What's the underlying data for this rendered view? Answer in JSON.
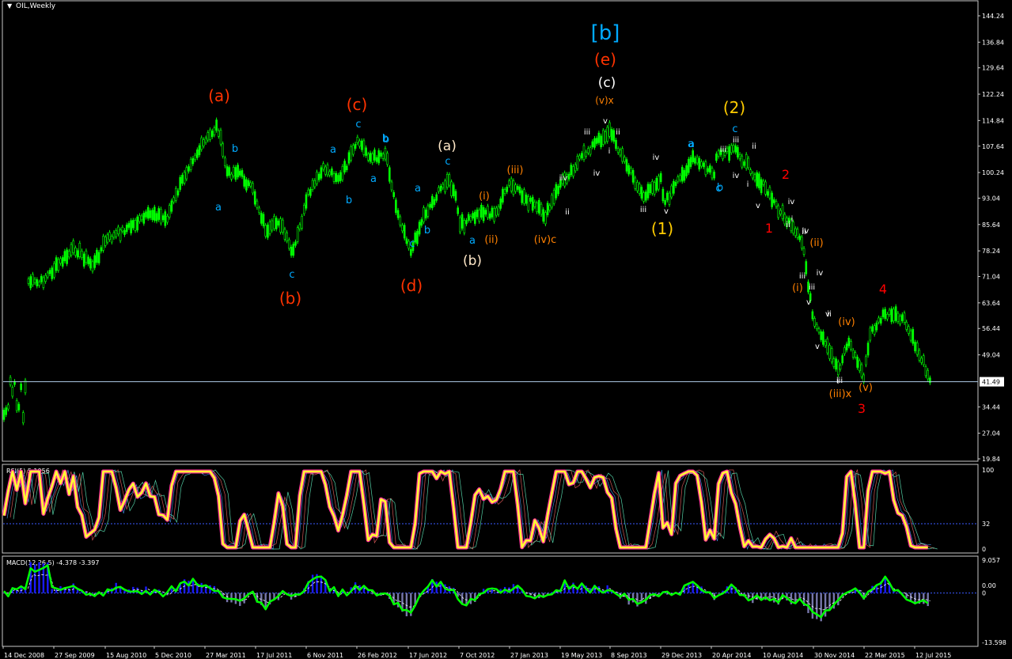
{
  "window": {
    "title": "OIL,Weekly",
    "menu_glyph": "▼"
  },
  "colors": {
    "background": "#000000",
    "frame": "#c8c8c8",
    "bull_candle": "#00ff00",
    "price_line": "#a8c4e0",
    "rsi_main": "#ffff33",
    "rsi_glow": "#ff3399",
    "macd_hist": "#1a1aff",
    "macd_line": "#00ff00",
    "signal_line": "#ffffff",
    "wave_red": "#ff3300",
    "wave_blue": "#00aaff",
    "wave_orange": "#ff8000",
    "wave_gold": "#ffcc00",
    "wave_white": "#ffffff",
    "wave_cream": "#ffe8c8",
    "wave_pure_red": "#ff0000"
  },
  "chart_data": [
    {
      "type": "candlestick",
      "title": "OIL,Weekly",
      "symbol": "OIL",
      "timeframe": "Weekly",
      "current_price": 41.49,
      "current_price_label": "41.49",
      "ylim": [
        19.84,
        144.24
      ],
      "y_ticks": [
        "144.24",
        "136.84",
        "129.64",
        "122.24",
        "114.84",
        "107.64",
        "100.24",
        "93.04",
        "85.64",
        "78.24",
        "71.04",
        "63.64",
        "56.44",
        "49.04",
        "41.49",
        "34.44",
        "27.04",
        "19.84"
      ],
      "x_ticks": [
        "14 Dec 2008",
        "27 Sep 2009",
        "15 Aug 2010",
        "5 Dec 2010",
        "27 Mar 2011",
        "17 Jul 2011",
        "6 Nov 2011",
        "26 Feb 2012",
        "17 Jun 2012",
        "7 Oct 2012",
        "27 Jan 2013",
        "19 May 2013",
        "8 Sep 2013",
        "29 Dec 2013",
        "20 Apr 2014",
        "10 Aug 2014",
        "30 Nov 2014",
        "22 Mar 2015",
        "12 Jul 2015"
      ],
      "price_path": [
        {
          "x": "14 Dec 2008",
          "y": 36.0
        },
        {
          "x": "Jan 2009",
          "y": 71.0
        },
        {
          "x": "Jun 2009",
          "y": 69.0
        },
        {
          "x": "27 Sep 2009",
          "y": 73.0
        },
        {
          "x": "Jan 2010",
          "y": 79.0
        },
        {
          "x": "May 2010",
          "y": 74.0
        },
        {
          "x": "15 Aug 2010",
          "y": 81.0
        },
        {
          "x": "5 Dec 2010",
          "y": 89.0
        },
        {
          "x": "Jan 2011",
          "y": 87.0
        },
        {
          "x": "Feb 2011",
          "y": 103.0
        },
        {
          "x": "Apr 2011",
          "y": 113.5
        },
        {
          "x": "May 2011",
          "y": 99.5
        },
        {
          "x": "Jun 2011",
          "y": 101.0
        },
        {
          "x": "Jul 2011",
          "y": 95.0
        },
        {
          "x": "Aug 2011",
          "y": 83.0
        },
        {
          "x": "Sep 2011",
          "y": 87.0
        },
        {
          "x": "Oct 2011",
          "y": 77.0
        },
        {
          "x": "Nov 2011",
          "y": 94.0
        },
        {
          "x": "Dec 2011",
          "y": 101.5
        },
        {
          "x": "Jan 2012",
          "y": 98.5
        },
        {
          "x": "Feb 2012",
          "y": 109.0
        },
        {
          "x": "Mar 2012",
          "y": 104.0
        },
        {
          "x": "Apr 2012",
          "y": 106.0
        },
        {
          "x": "May 2012",
          "y": 91.0
        },
        {
          "x": "Jun 2012",
          "y": 78.0
        },
        {
          "x": "Jul 2012",
          "y": 88.0
        },
        {
          "x": "Aug 2012",
          "y": 98.5
        },
        {
          "x": "Sep 2012",
          "y": 92.0
        },
        {
          "x": "7 Oct 2012",
          "y": 85.0
        },
        {
          "x": "Nov 2012",
          "y": 89.5
        },
        {
          "x": "Dec 2012",
          "y": 88.0
        },
        {
          "x": "27 Jan 2013",
          "y": 97.0
        },
        {
          "x": "Apr 2013",
          "y": 88.0
        },
        {
          "x": "19 May 2013",
          "y": 97.0
        },
        {
          "x": "Jul 2013",
          "y": 107.0
        },
        {
          "x": "8 Sep 2013",
          "y": 112.0
        },
        {
          "x": "Oct 2013",
          "y": 101.0
        },
        {
          "x": "Nov 2013",
          "y": 93.0
        },
        {
          "x": "29 Dec 2013",
          "y": 99.0
        },
        {
          "x": "Jan 2014",
          "y": 91.5
        },
        {
          "x": "Mar 2014",
          "y": 104.0
        },
        {
          "x": "Apr 2014",
          "y": 99.5
        },
        {
          "x": "20 Apr 2014",
          "y": 104.0
        },
        {
          "x": "Jun 2014",
          "y": 106.5
        },
        {
          "x": "10 Aug 2014",
          "y": 97.0
        },
        {
          "x": "Sep 2014",
          "y": 92.0
        },
        {
          "x": "Oct 2014",
          "y": 80.0
        },
        {
          "x": "30 Nov 2014",
          "y": 58.0
        },
        {
          "x": "Jan 2015",
          "y": 45.0
        },
        {
          "x": "Feb 2015",
          "y": 53.0
        },
        {
          "x": "22 Mar 2015",
          "y": 43.0
        },
        {
          "x": "Apr 2015",
          "y": 55.0
        },
        {
          "x": "May 2015",
          "y": 60.5
        },
        {
          "x": "Jun 2015",
          "y": 59.0
        },
        {
          "x": "12 Jul 2015",
          "y": 41.5
        }
      ],
      "wave_labels": [
        {
          "text": "(a)",
          "color": "#ff3300",
          "size": 20
        },
        {
          "text": "(b)",
          "color": "#ff3300",
          "size": 20
        },
        {
          "text": "(c)",
          "color": "#ff3300",
          "size": 20
        },
        {
          "text": "(d)",
          "color": "#ff3300",
          "size": 20
        },
        {
          "text": "(e)",
          "color": "#ff3300",
          "size": 20
        },
        {
          "text": "[b]",
          "color": "#00aaff",
          "size": 26
        },
        {
          "text": "(c)",
          "color": "#ffffff",
          "size": 17
        },
        {
          "text": "(v)x",
          "color": "#ff8000",
          "size": 12
        },
        {
          "text": "(a)",
          "color": "#ffe8c8",
          "size": 17
        },
        {
          "text": "(b)",
          "color": "#ffe8c8",
          "size": 17
        },
        {
          "text": "(1)",
          "color": "#ffcc00",
          "size": 20
        },
        {
          "text": "(2)",
          "color": "#ffcc00",
          "size": 20
        },
        {
          "text": "1",
          "color": "#ff0000",
          "size": 16
        },
        {
          "text": "2",
          "color": "#ff0000",
          "size": 16
        },
        {
          "text": "3",
          "color": "#ff0000",
          "size": 16
        },
        {
          "text": "4",
          "color": "#ff0000",
          "size": 16
        },
        {
          "text": "a",
          "color": "#00aaff",
          "size": 13
        },
        {
          "text": "b",
          "color": "#00aaff",
          "size": 13
        },
        {
          "text": "c",
          "color": "#00aaff",
          "size": 13
        },
        {
          "text": "b",
          "color": "#00aaff",
          "size": 13
        },
        {
          "text": "a",
          "color": "#00aaff",
          "size": 13
        },
        {
          "text": "b",
          "color": "#00aaff",
          "size": 13
        },
        {
          "text": "c",
          "color": "#00aaff",
          "size": 13
        },
        {
          "text": "c",
          "color": "#00aaff",
          "size": 13
        },
        {
          "text": "a",
          "color": "#00aaff",
          "size": 13
        },
        {
          "text": "b",
          "color": "#00aaff",
          "size": 13
        },
        {
          "text": "a",
          "color": "#00aaff",
          "size": 13
        },
        {
          "text": "c",
          "color": "#00aaff",
          "size": 13
        },
        {
          "text": "a",
          "color": "#00aaff",
          "size": 13
        },
        {
          "text": "b",
          "color": "#00aaff",
          "size": 13
        },
        {
          "text": "c",
          "color": "#00aaff",
          "size": 13
        },
        {
          "text": "a",
          "color": "#00aaff",
          "size": 13
        },
        {
          "text": "b",
          "color": "#00aaff",
          "size": 13
        },
        {
          "text": "c",
          "color": "#00aaff",
          "size": 13
        },
        {
          "text": "a",
          "color": "#00aaff",
          "size": 13
        },
        {
          "text": "(i)",
          "color": "#ff8000",
          "size": 13
        },
        {
          "text": "(ii)",
          "color": "#ff8000",
          "size": 13
        },
        {
          "text": "(iii)",
          "color": "#ff8000",
          "size": 13
        },
        {
          "text": "(iv)c",
          "color": "#ff8000",
          "size": 13
        },
        {
          "text": "(i)",
          "color": "#ff8000",
          "size": 13
        },
        {
          "text": "(ii)",
          "color": "#ff8000",
          "size": 13
        },
        {
          "text": "(iv)",
          "color": "#ff8000",
          "size": 13
        },
        {
          "text": "(iii)x",
          "color": "#ff8000",
          "size": 13
        },
        {
          "text": "(v)",
          "color": "#ff8000",
          "size": 13
        },
        {
          "text": "i",
          "color": "#ffffff",
          "size": 10
        },
        {
          "text": "ii",
          "color": "#ffffff",
          "size": 10
        },
        {
          "text": "iii",
          "color": "#ffffff",
          "size": 10
        },
        {
          "text": "iv",
          "color": "#ffffff",
          "size": 10
        },
        {
          "text": "v",
          "color": "#ffffff",
          "size": 10
        },
        {
          "text": "i",
          "color": "#ffffff",
          "size": 10
        },
        {
          "text": "ii",
          "color": "#ffffff",
          "size": 10
        },
        {
          "text": "iii",
          "color": "#ffffff",
          "size": 10
        },
        {
          "text": "iv",
          "color": "#ffffff",
          "size": 10
        },
        {
          "text": "v",
          "color": "#ffffff",
          "size": 10
        },
        {
          "text": "iii",
          "color": "#ffffff",
          "size": 10
        },
        {
          "text": "iv",
          "color": "#ffffff",
          "size": 10
        },
        {
          "text": "i",
          "color": "#ffffff",
          "size": 10
        },
        {
          "text": "ii",
          "color": "#ffffff",
          "size": 10
        },
        {
          "text": "iii",
          "color": "#ffffff",
          "size": 10
        },
        {
          "text": "iv",
          "color": "#ffffff",
          "size": 10
        },
        {
          "text": "v",
          "color": "#ffffff",
          "size": 10
        },
        {
          "text": "ii",
          "color": "#ffffff",
          "size": 10
        },
        {
          "text": "iii",
          "color": "#ffffff",
          "size": 10
        },
        {
          "text": "iv",
          "color": "#ffffff",
          "size": 10
        },
        {
          "text": "v",
          "color": "#ffffff",
          "size": 10
        },
        {
          "text": "ii",
          "color": "#ffffff",
          "size": 10
        },
        {
          "text": "iii",
          "color": "#ffffff",
          "size": 10
        },
        {
          "text": "iv",
          "color": "#ffffff",
          "size": 10
        },
        {
          "text": "i",
          "color": "#ffffff",
          "size": 10
        },
        {
          "text": "v",
          "color": "#ffffff",
          "size": 10
        },
        {
          "text": "i",
          "color": "#ffffff",
          "size": 10
        },
        {
          "text": "ii",
          "color": "#ffffff",
          "size": 10
        },
        {
          "text": "iii",
          "color": "#ffffff",
          "size": 10
        },
        {
          "text": "iv",
          "color": "#ffffff",
          "size": 10
        },
        {
          "text": "v",
          "color": "#ffffff",
          "size": 10
        }
      ]
    },
    {
      "type": "line",
      "title": "RSI(5) 5.1956",
      "ylim": [
        0,
        100
      ],
      "y_ticks": [
        "100",
        "32",
        "0"
      ],
      "level": 32,
      "last_value": 5.1956
    },
    {
      "type": "bar",
      "title": "MACD(12,26,5) -4.378 -3.397",
      "ylim": [
        -13.598,
        9.057
      ],
      "y_ticks": [
        "9.057",
        "0.00",
        "0",
        "-13.598"
      ],
      "last_macd": -4.378,
      "last_signal": -3.397
    }
  ]
}
